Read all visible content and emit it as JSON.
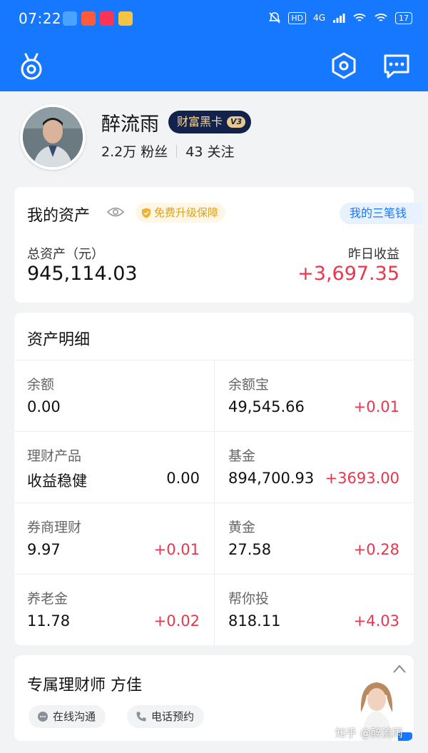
{
  "status_bar": {
    "time": "07:22",
    "hd": "HD",
    "network": "4G",
    "battery": "17"
  },
  "profile": {
    "username": "醉流雨",
    "vip_label": "财富黑卡",
    "vip_level": "V3",
    "followers": "2.2万 粉丝",
    "following": "43 关注"
  },
  "assets": {
    "title": "我的资产",
    "upgrade_label": "免费升级保障",
    "my_money_label": "我的三笔钱",
    "total_label": "总资产（元）",
    "total_value": "945,114.03",
    "yesterday_label": "昨日收益",
    "yesterday_value": "+3,697.35"
  },
  "details": {
    "title": "资产明细",
    "items": [
      {
        "name": "余额",
        "amount": "0.00",
        "change": ""
      },
      {
        "name": "余额宝",
        "amount": "49,545.66",
        "change": "+0.01"
      },
      {
        "name": "理财产品",
        "amount": "收益稳健",
        "change": "0.00"
      },
      {
        "name": "基金",
        "amount": "894,700.93",
        "change": "+3693.00"
      },
      {
        "name": "券商理财",
        "amount": "9.97",
        "change": "+0.01"
      },
      {
        "name": "黄金",
        "amount": "27.58",
        "change": "+0.28"
      },
      {
        "name": "养老金",
        "amount": "11.78",
        "change": "+0.02"
      },
      {
        "name": "帮你投",
        "amount": "818.11",
        "change": "+4.03"
      }
    ]
  },
  "advisor": {
    "title": "专属理财师 方佳",
    "chat_label": "在线沟通",
    "phone_label": "电话预约"
  },
  "watermark": "知乎 @醉流雨",
  "colors": {
    "brand_blue": "#1677ff",
    "gain_red": "#e8374d",
    "vip_dark": "#13224a"
  }
}
